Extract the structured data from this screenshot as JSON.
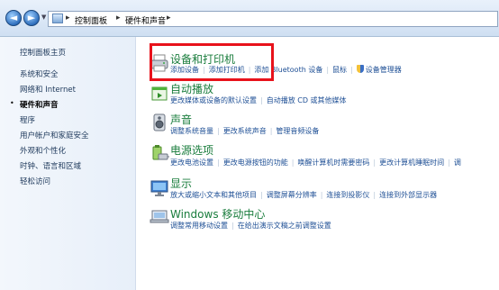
{
  "address_bar": {
    "back_glyph": "◄",
    "forward_glyph": "►",
    "dropdown_glyph": "▼",
    "separator": "▸",
    "crumbs": [
      "控制面板",
      "硬件和声音"
    ]
  },
  "left_nav": {
    "home": "控制面板主页",
    "bullet": "•",
    "items": [
      "系统和安全",
      "网络和 Internet",
      "硬件和声音",
      "程序",
      "用户帐户和家庭安全",
      "外观和个性化",
      "时钟、语言和区域",
      "轻松访问"
    ],
    "current_index": 2
  },
  "categories": [
    {
      "title": "设备和打印机",
      "icon": "printer-icon",
      "links": [
        "添加设备",
        "添加打印机",
        "添加 Bluetooth 设备",
        "鼠标",
        "设备管理器"
      ]
    },
    {
      "title": "自动播放",
      "icon": "autoplay-icon",
      "links": [
        "更改媒体或设备的默认设置",
        "自动播放 CD 或其他媒体"
      ]
    },
    {
      "title": "声音",
      "icon": "speaker-icon",
      "links": [
        "调整系统音量",
        "更改系统声音",
        "管理音频设备"
      ]
    },
    {
      "title": "电源选项",
      "icon": "power-icon",
      "links": [
        "更改电池设置",
        "更改电源按钮的功能",
        "唤醒计算机时需要密码",
        "更改计算机睡眠时间",
        "调"
      ]
    },
    {
      "title": "显示",
      "icon": "monitor-icon",
      "links": [
        "放大或缩小文本和其他项目",
        "调整屏幕分辨率",
        "连接到投影仪",
        "连接到外部显示器"
      ]
    },
    {
      "title": "Windows 移动中心",
      "icon": "mobility-center-icon",
      "links": [
        "调整常用移动设置",
        "在给出演示文稿之前调整设置"
      ]
    }
  ],
  "colors": {
    "category_title": "#1a7d3d",
    "link": "#1e4f95",
    "highlight_box": "#e8121b"
  }
}
